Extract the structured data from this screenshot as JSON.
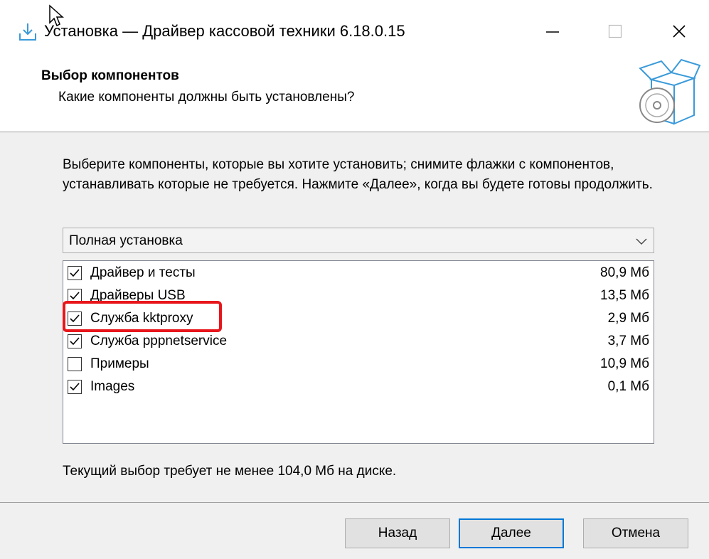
{
  "window": {
    "title": "Установка — Драйвер кассовой техники  6.18.0.15"
  },
  "header": {
    "title": "Выбор компонентов",
    "subtitle": "Какие компоненты должны быть установлены?"
  },
  "instructions": "Выберите компоненты, которые вы хотите установить; снимите флажки с компонентов, устанавливать которые не требуется. Нажмите «Далее», когда вы будете готовы продолжить.",
  "install_type": {
    "selected": "Полная установка"
  },
  "components": [
    {
      "label": "Драйвер и тесты",
      "size": "80,9 Мб",
      "checked": true
    },
    {
      "label": "Драйверы USB",
      "size": "13,5 Мб",
      "checked": true
    },
    {
      "label": "Служба kktproxy",
      "size": "2,9 Мб",
      "checked": true
    },
    {
      "label": "Служба pppnetservice",
      "size": "3,7 Мб",
      "checked": true
    },
    {
      "label": "Примеры",
      "size": "10,9 Мб",
      "checked": false
    },
    {
      "label": "Images",
      "size": "0,1 Мб",
      "checked": true
    }
  ],
  "disk_requirement": "Текущий выбор требует не менее 104,0 Мб на диске.",
  "buttons": {
    "back": "Назад",
    "next": "Далее",
    "cancel": "Отмена"
  },
  "colors": {
    "highlight": "#e8161b",
    "default_button_border": "#0078d7",
    "icon_blue": "#3a9ad9"
  }
}
